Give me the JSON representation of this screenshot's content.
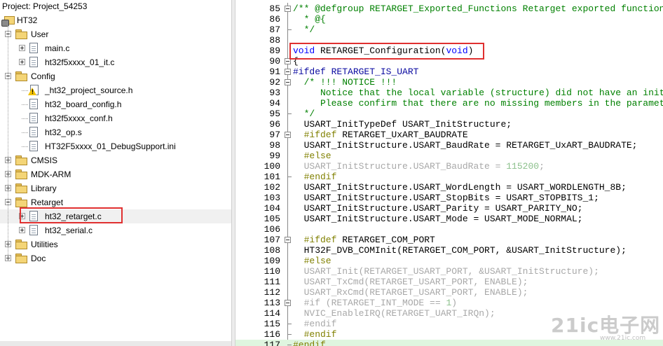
{
  "tree": {
    "title": "Project: Project_54253",
    "root": "HT32",
    "rows": [
      {
        "label": "User",
        "kind": "folder",
        "level": 1,
        "toggle": "minus"
      },
      {
        "label": "main.c",
        "kind": "file",
        "level": 2,
        "toggle": "plus"
      },
      {
        "label": "ht32f5xxxx_01_it.c",
        "kind": "file",
        "level": 2,
        "toggle": "plus"
      },
      {
        "label": "Config",
        "kind": "folder",
        "level": 1,
        "toggle": "minus"
      },
      {
        "label": "_ht32_project_source.h",
        "kind": "warning-file",
        "level": 2,
        "toggle": ""
      },
      {
        "label": "ht32_board_config.h",
        "kind": "file",
        "level": 2,
        "toggle": ""
      },
      {
        "label": "ht32f5xxxx_conf.h",
        "kind": "file",
        "level": 2,
        "toggle": ""
      },
      {
        "label": "ht32_op.s",
        "kind": "file",
        "level": 2,
        "toggle": ""
      },
      {
        "label": "HT32F5xxxx_01_DebugSupport.ini",
        "kind": "file",
        "level": 2,
        "toggle": ""
      },
      {
        "label": "CMSIS",
        "kind": "folder",
        "level": 1,
        "toggle": "plus"
      },
      {
        "label": "MDK-ARM",
        "kind": "folder",
        "level": 1,
        "toggle": "plus"
      },
      {
        "label": "Library",
        "kind": "folder",
        "level": 1,
        "toggle": "plus"
      },
      {
        "label": "Retarget",
        "kind": "folder",
        "level": 1,
        "toggle": "minus"
      },
      {
        "label": "ht32_retarget.c",
        "kind": "file",
        "level": 2,
        "toggle": "plus",
        "selected": true
      },
      {
        "label": "ht32_serial.c",
        "kind": "file",
        "level": 2,
        "toggle": "plus"
      },
      {
        "label": "Utilities",
        "kind": "folder",
        "level": 1,
        "toggle": "plus"
      },
      {
        "label": "Doc",
        "kind": "folder",
        "level": 1,
        "toggle": "plus"
      }
    ]
  },
  "editor": {
    "lines": [
      {
        "n": "85",
        "fold": "box",
        "segs": [
          [
            "cm",
            "/** @defgroup RETARGET_Exported_Functions Retarget exported functions"
          ]
        ]
      },
      {
        "n": "86",
        "segs": [
          [
            "cm",
            "  * @{"
          ]
        ]
      },
      {
        "n": "87",
        "fold": "tick",
        "segs": [
          [
            "cm",
            "  */"
          ]
        ]
      },
      {
        "n": "88",
        "segs": []
      },
      {
        "n": "89",
        "segs": [
          [
            "kw",
            "void"
          ],
          [
            "",
            " RETARGET_Configuration("
          ],
          [
            "kw",
            "void"
          ],
          [
            "",
            ")"
          ]
        ]
      },
      {
        "n": "90",
        "fold": "box",
        "segs": [
          [
            "",
            "{"
          ]
        ]
      },
      {
        "n": "91",
        "fold": "box",
        "segs": [
          [
            "pp",
            "#ifdef RETARGET_IS_UART"
          ]
        ]
      },
      {
        "n": "92",
        "fold": "box",
        "segs": [
          [
            "cm",
            "  /* !!! NOTICE !!!"
          ]
        ]
      },
      {
        "n": "93",
        "segs": [
          [
            "cm",
            "     Notice that the local variable (structure) did not have an initial value."
          ]
        ]
      },
      {
        "n": "94",
        "segs": [
          [
            "cm",
            "     Please confirm that there are no missing members in the parameter settings below."
          ]
        ]
      },
      {
        "n": "95",
        "fold": "tick",
        "segs": [
          [
            "cm",
            "  */"
          ]
        ]
      },
      {
        "n": "96",
        "segs": [
          [
            "",
            "  USART_InitTypeDef USART_InitStructure;"
          ]
        ]
      },
      {
        "n": "97",
        "fold": "box",
        "segs": [
          [
            "pp-kw",
            "  #ifdef"
          ],
          [
            "",
            " RETARGET_UxART_BAUDRATE"
          ]
        ]
      },
      {
        "n": "98",
        "segs": [
          [
            "",
            "  USART_InitStructure.USART_BaudRate = RETARGET_UxART_BAUDRATE;"
          ]
        ]
      },
      {
        "n": "99",
        "segs": [
          [
            "pp-kw",
            "  #else"
          ]
        ]
      },
      {
        "n": "100",
        "segs": [
          [
            "dis",
            "  USART_InitStructure.USART_BaudRate = "
          ],
          [
            "dnum",
            "115200"
          ],
          [
            "dis",
            ";"
          ]
        ]
      },
      {
        "n": "101",
        "fold": "tick",
        "segs": [
          [
            "pp-kw",
            "  #endif"
          ]
        ]
      },
      {
        "n": "102",
        "segs": [
          [
            "",
            "  USART_InitStructure.USART_WordLength = USART_WORDLENGTH_8B;"
          ]
        ]
      },
      {
        "n": "103",
        "segs": [
          [
            "",
            "  USART_InitStructure.USART_StopBits = USART_STOPBITS_1;"
          ]
        ]
      },
      {
        "n": "104",
        "segs": [
          [
            "",
            "  USART_InitStructure.USART_Parity = USART_PARITY_NO;"
          ]
        ]
      },
      {
        "n": "105",
        "segs": [
          [
            "",
            "  USART_InitStructure.USART_Mode = USART_MODE_NORMAL;"
          ]
        ]
      },
      {
        "n": "106",
        "segs": []
      },
      {
        "n": "107",
        "fold": "box",
        "segs": [
          [
            "pp-kw",
            "  #ifdef"
          ],
          [
            "",
            " RETARGET_COM_PORT"
          ]
        ]
      },
      {
        "n": "108",
        "segs": [
          [
            "",
            "  HT32F_DVB_COMInit(RETARGET_COM_PORT, &USART_InitStructure);"
          ]
        ]
      },
      {
        "n": "109",
        "segs": [
          [
            "pp-kw",
            "  #else"
          ]
        ]
      },
      {
        "n": "110",
        "segs": [
          [
            "dis",
            "  USART_Init(RETARGET_USART_PORT, &USART_InitStructure);"
          ]
        ]
      },
      {
        "n": "111",
        "segs": [
          [
            "dis",
            "  USART_TxCmd(RETARGET_USART_PORT, ENABLE);"
          ]
        ]
      },
      {
        "n": "112",
        "segs": [
          [
            "dis",
            "  USART_RxCmd(RETARGET_USART_PORT, ENABLE);"
          ]
        ]
      },
      {
        "n": "113",
        "fold": "box",
        "segs": [
          [
            "dis",
            "  #if (RETARGET_INT_MODE == "
          ],
          [
            "dnum",
            "1"
          ],
          [
            "dis",
            ")"
          ]
        ]
      },
      {
        "n": "114",
        "segs": [
          [
            "dis",
            "  NVIC_EnableIRQ(RETARGET_UART_IRQn);"
          ]
        ]
      },
      {
        "n": "115",
        "fold": "tick",
        "segs": [
          [
            "dis",
            "  #endif"
          ]
        ]
      },
      {
        "n": "116",
        "fold": "tick",
        "segs": [
          [
            "pp-kw",
            "  #endif"
          ]
        ]
      },
      {
        "n": "117",
        "fold": "tick",
        "hl": true,
        "segs": [
          [
            "pp-kw",
            "#endif"
          ]
        ]
      }
    ]
  },
  "watermark": {
    "text": "21ic电子网",
    "url": "www.21ic.com"
  }
}
